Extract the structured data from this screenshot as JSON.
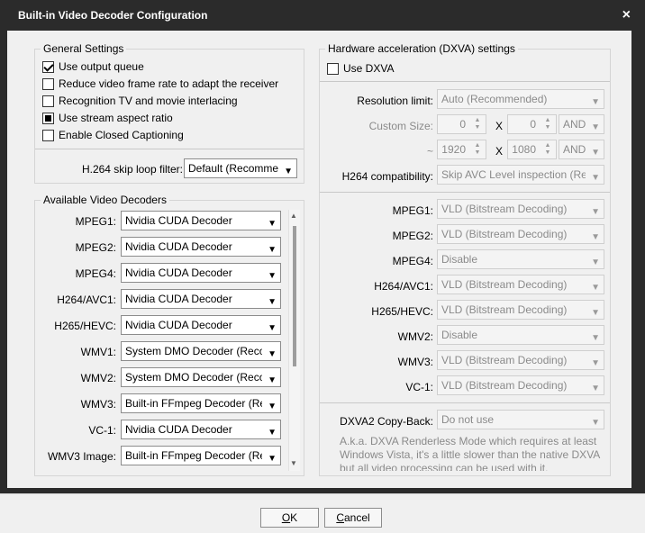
{
  "window": {
    "title": "Built-in Video Decoder Configuration",
    "close_glyph": "×"
  },
  "general": {
    "title": "General Settings",
    "checkboxes": [
      {
        "label": "Use output queue",
        "state": "checked"
      },
      {
        "label": "Reduce video frame rate to adapt the receiver",
        "state": "unchecked"
      },
      {
        "label": "Recognition TV and movie interlacing",
        "state": "unchecked"
      },
      {
        "label": "Use stream aspect ratio",
        "state": "indeterminate"
      },
      {
        "label": "Enable Closed Captioning",
        "state": "unchecked"
      }
    ],
    "h264_skip_label": "H.264 skip loop filter:",
    "h264_skip_value": "Default (Recommended)"
  },
  "decoders": {
    "title": "Available Video Decoders",
    "rows": [
      {
        "label": "MPEG1:",
        "value": "Nvidia CUDA Decoder"
      },
      {
        "label": "MPEG2:",
        "value": "Nvidia CUDA Decoder"
      },
      {
        "label": "MPEG4:",
        "value": "Nvidia CUDA Decoder"
      },
      {
        "label": "H264/AVC1:",
        "value": "Nvidia CUDA Decoder"
      },
      {
        "label": "H265/HEVC:",
        "value": "Nvidia CUDA Decoder"
      },
      {
        "label": "WMV1:",
        "value": "System DMO Decoder (Recommended)"
      },
      {
        "label": "WMV2:",
        "value": "System DMO Decoder (Recommended)"
      },
      {
        "label": "WMV3:",
        "value": "Built-in FFmpeg Decoder (Recommended)"
      },
      {
        "label": "VC-1:",
        "value": "Nvidia CUDA Decoder"
      },
      {
        "label": "WMV3 Image:",
        "value": "Built-in FFmpeg Decoder (Recommended)"
      }
    ]
  },
  "dxva": {
    "title": "Hardware acceleration (DXVA) settings",
    "use_dxva_label": "Use DXVA",
    "resolution_label": "Resolution limit:",
    "resolution_value": "Auto (Recommended)",
    "custom_size_label": "Custom Size:",
    "custom_w1": "0",
    "custom_h1": "0",
    "x_label": "X",
    "and_label": "AND",
    "tilde_label": "~",
    "custom_w2": "1920",
    "custom_h2": "1080",
    "compat_label": "H264 compatibility:",
    "compat_value": "Skip AVC Level inspection (Recommended)",
    "codecs": [
      {
        "label": "MPEG1:",
        "value": "VLD (Bitstream Decoding)"
      },
      {
        "label": "MPEG2:",
        "value": "VLD (Bitstream Decoding)"
      },
      {
        "label": "MPEG4:",
        "value": "Disable"
      },
      {
        "label": "H264/AVC1:",
        "value": "VLD (Bitstream Decoding)"
      },
      {
        "label": "H265/HEVC:",
        "value": "VLD (Bitstream Decoding)"
      },
      {
        "label": "WMV2:",
        "value": "Disable"
      },
      {
        "label": "WMV3:",
        "value": "VLD (Bitstream Decoding)"
      },
      {
        "label": "VC-1:",
        "value": "VLD (Bitstream Decoding)"
      }
    ],
    "copyback_label": "DXVA2 Copy-Back:",
    "copyback_value": "Do not use",
    "note": "A.k.a. DXVA Renderless Mode which requires at least Windows Vista, it's a little slower than the native DXVA but all video processing can be used with it."
  },
  "buttons": {
    "ok_accel": "O",
    "ok_rest": "K",
    "cancel_accel": "C",
    "cancel_rest": "ancel"
  },
  "glyphs": {
    "dropdown": "▼",
    "spin_up": "▲",
    "spin_down": "▼",
    "scroll_up": "▲",
    "scroll_down": "▼"
  }
}
